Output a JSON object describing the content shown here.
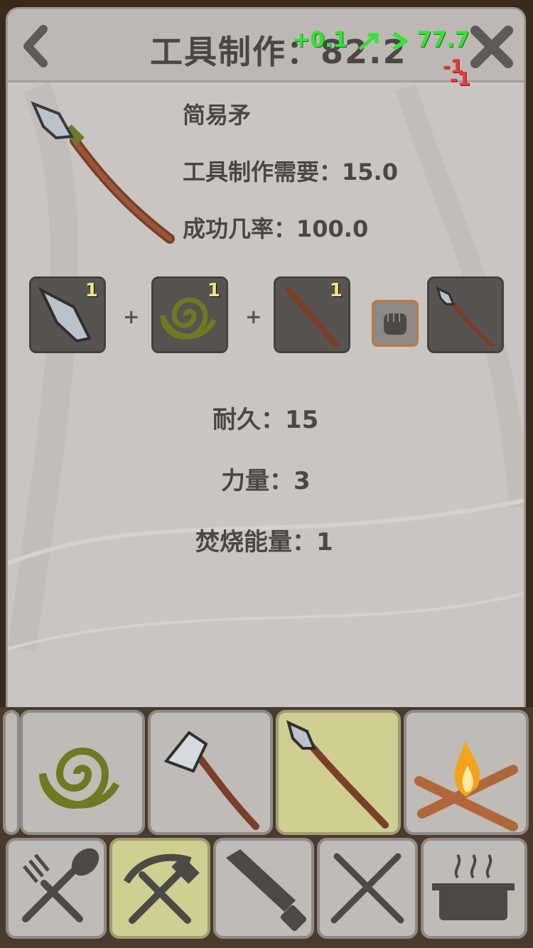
{
  "header": {
    "title": "工具制作：82.2",
    "xp_gain": "+0.1",
    "xp_value": "77.7",
    "loss_1": "-1",
    "loss_2": "-1"
  },
  "item": {
    "name": "简易矛",
    "requirement_label": "工具制作需要：15.0",
    "success_label": "成功几率：100.0"
  },
  "recipe": {
    "ingredients": [
      {
        "icon": "stone-blade-icon",
        "count": "1"
      },
      {
        "icon": "rope-coil-icon",
        "count": "1"
      },
      {
        "icon": "stick-icon",
        "count": "1"
      }
    ],
    "plus": "+",
    "tool_icon": "fist-icon",
    "result_icon": "spear-icon"
  },
  "stats": {
    "durability": "耐久：15",
    "strength": "力量：3",
    "burn_energy": "焚烧能量：1"
  },
  "recipe_tiles": [
    {
      "icon": "rope-coil-icon",
      "active": false
    },
    {
      "icon": "stone-axe-icon",
      "active": false
    },
    {
      "icon": "spear-icon",
      "active": true
    },
    {
      "icon": "campfire-icon",
      "active": false
    }
  ],
  "category_tabs": [
    {
      "icon": "fork-spoon-icon",
      "active": false
    },
    {
      "icon": "pickaxe-hammer-icon",
      "active": true
    },
    {
      "icon": "saw-icon",
      "active": false
    },
    {
      "icon": "crossed-knives-icon",
      "active": false
    },
    {
      "icon": "cooking-pot-icon",
      "active": false
    }
  ],
  "colors": {
    "panel": "#c9c5c2",
    "slot": "#575351",
    "active_tile": "#cfcf92",
    "xp_green": "#38e038",
    "loss_red": "#e83a3a"
  }
}
